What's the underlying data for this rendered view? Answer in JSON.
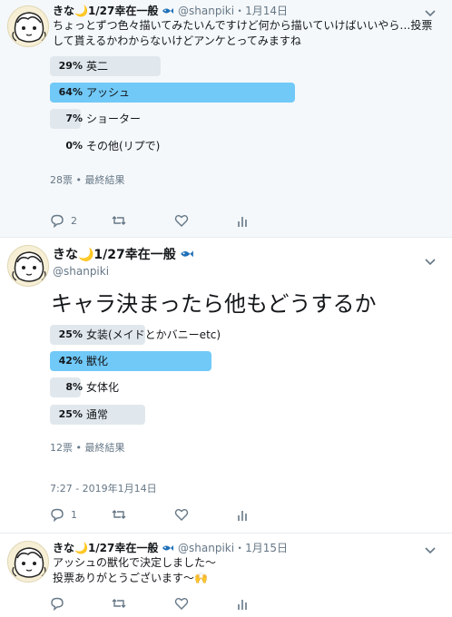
{
  "tweets": [
    {
      "name": "きな🌙1/27幸在一般",
      "handle": "@shanpiki",
      "dot": "・",
      "date": "1月14日",
      "text_lines": [
        "ちょっとずつ色々描いてみたいんですけど何から描いていけばいいやら…投票",
        "して貰えるかわからないけどアンケとってみますね"
      ],
      "poll": [
        {
          "pct": "29%",
          "label": "英二",
          "fraction": 0.29,
          "winner": false
        },
        {
          "pct": "64%",
          "label": "アッシュ",
          "fraction": 0.64,
          "winner": true
        },
        {
          "pct": "7%",
          "label": "ショーター",
          "fraction": 0.07,
          "winner": false
        },
        {
          "pct": "0%",
          "label": "その他(リプで)",
          "fraction": 0.0,
          "winner": false
        }
      ],
      "poll_meta": "28票 • 最終結果",
      "reply_count": "2"
    },
    {
      "name": "きな🌙1/27幸在一般",
      "handle": "@shanpiki",
      "text": "キャラ決まったら他もどうするか",
      "poll": [
        {
          "pct": "25%",
          "label": "女装(メイドとかバニーetc)",
          "fraction": 0.25,
          "winner": false
        },
        {
          "pct": "42%",
          "label": "獣化",
          "fraction": 0.42,
          "winner": true
        },
        {
          "pct": "8%",
          "label": "女体化",
          "fraction": 0.08,
          "winner": false
        },
        {
          "pct": "25%",
          "label": "通常",
          "fraction": 0.25,
          "winner": false
        }
      ],
      "poll_meta": "12票 • 最終結果",
      "timestamp": "7:27 - 2019年1月14日",
      "reply_count": "1"
    },
    {
      "name": "きな🌙1/27幸在一般",
      "handle": "@shanpiki",
      "dot": "・",
      "date": "1月15日",
      "text_lines": [
        "アッシュの獣化で決定しました～",
        "投票ありがとうございます～🙌"
      ]
    }
  ],
  "icons": {
    "reply": "reply-icon",
    "retweet": "retweet-icon",
    "like": "heart-icon",
    "analytics": "analytics-icon",
    "more": "chevron-down-icon",
    "fish": "fish-icon"
  },
  "colors": {
    "accent": "#1da1f2",
    "poll_winner": "#71c9f8",
    "poll_other": "#e1e8ed",
    "muted": "#657786"
  }
}
